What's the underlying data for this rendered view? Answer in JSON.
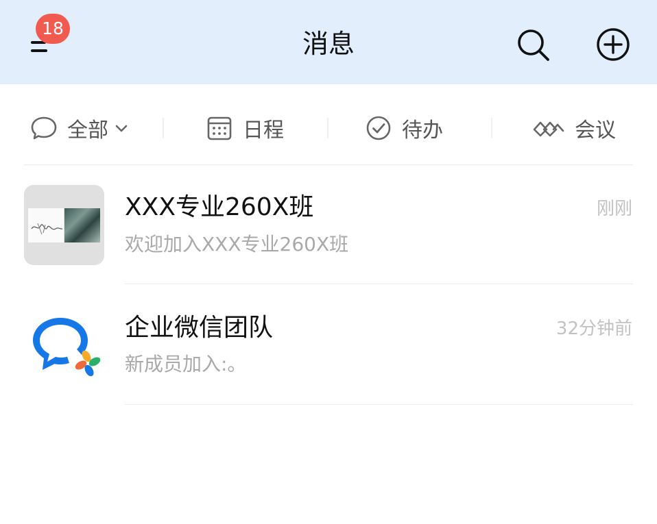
{
  "header": {
    "title": "消息",
    "unread_badge": "18"
  },
  "filters": [
    {
      "label": "全部",
      "icon": "chat-bubble-icon",
      "has_dropdown": true
    },
    {
      "label": "日程",
      "icon": "calendar-icon"
    },
    {
      "label": "待办",
      "icon": "check-circle-icon"
    },
    {
      "label": "会议",
      "icon": "meeting-icon"
    }
  ],
  "conversations": [
    {
      "name": "XXX专业260X班",
      "preview": "欢迎加入XXX专业260X班",
      "time": "刚刚",
      "avatar": "group-avatar"
    },
    {
      "name": "企业微信团队",
      "preview": "新成员加入:。",
      "time": "32分钟前",
      "avatar": "wecom-logo-icon"
    }
  ],
  "colors": {
    "header_bg": "#e3eefc",
    "badge": "#f05a4f",
    "brand_blue": "#1678e6"
  }
}
